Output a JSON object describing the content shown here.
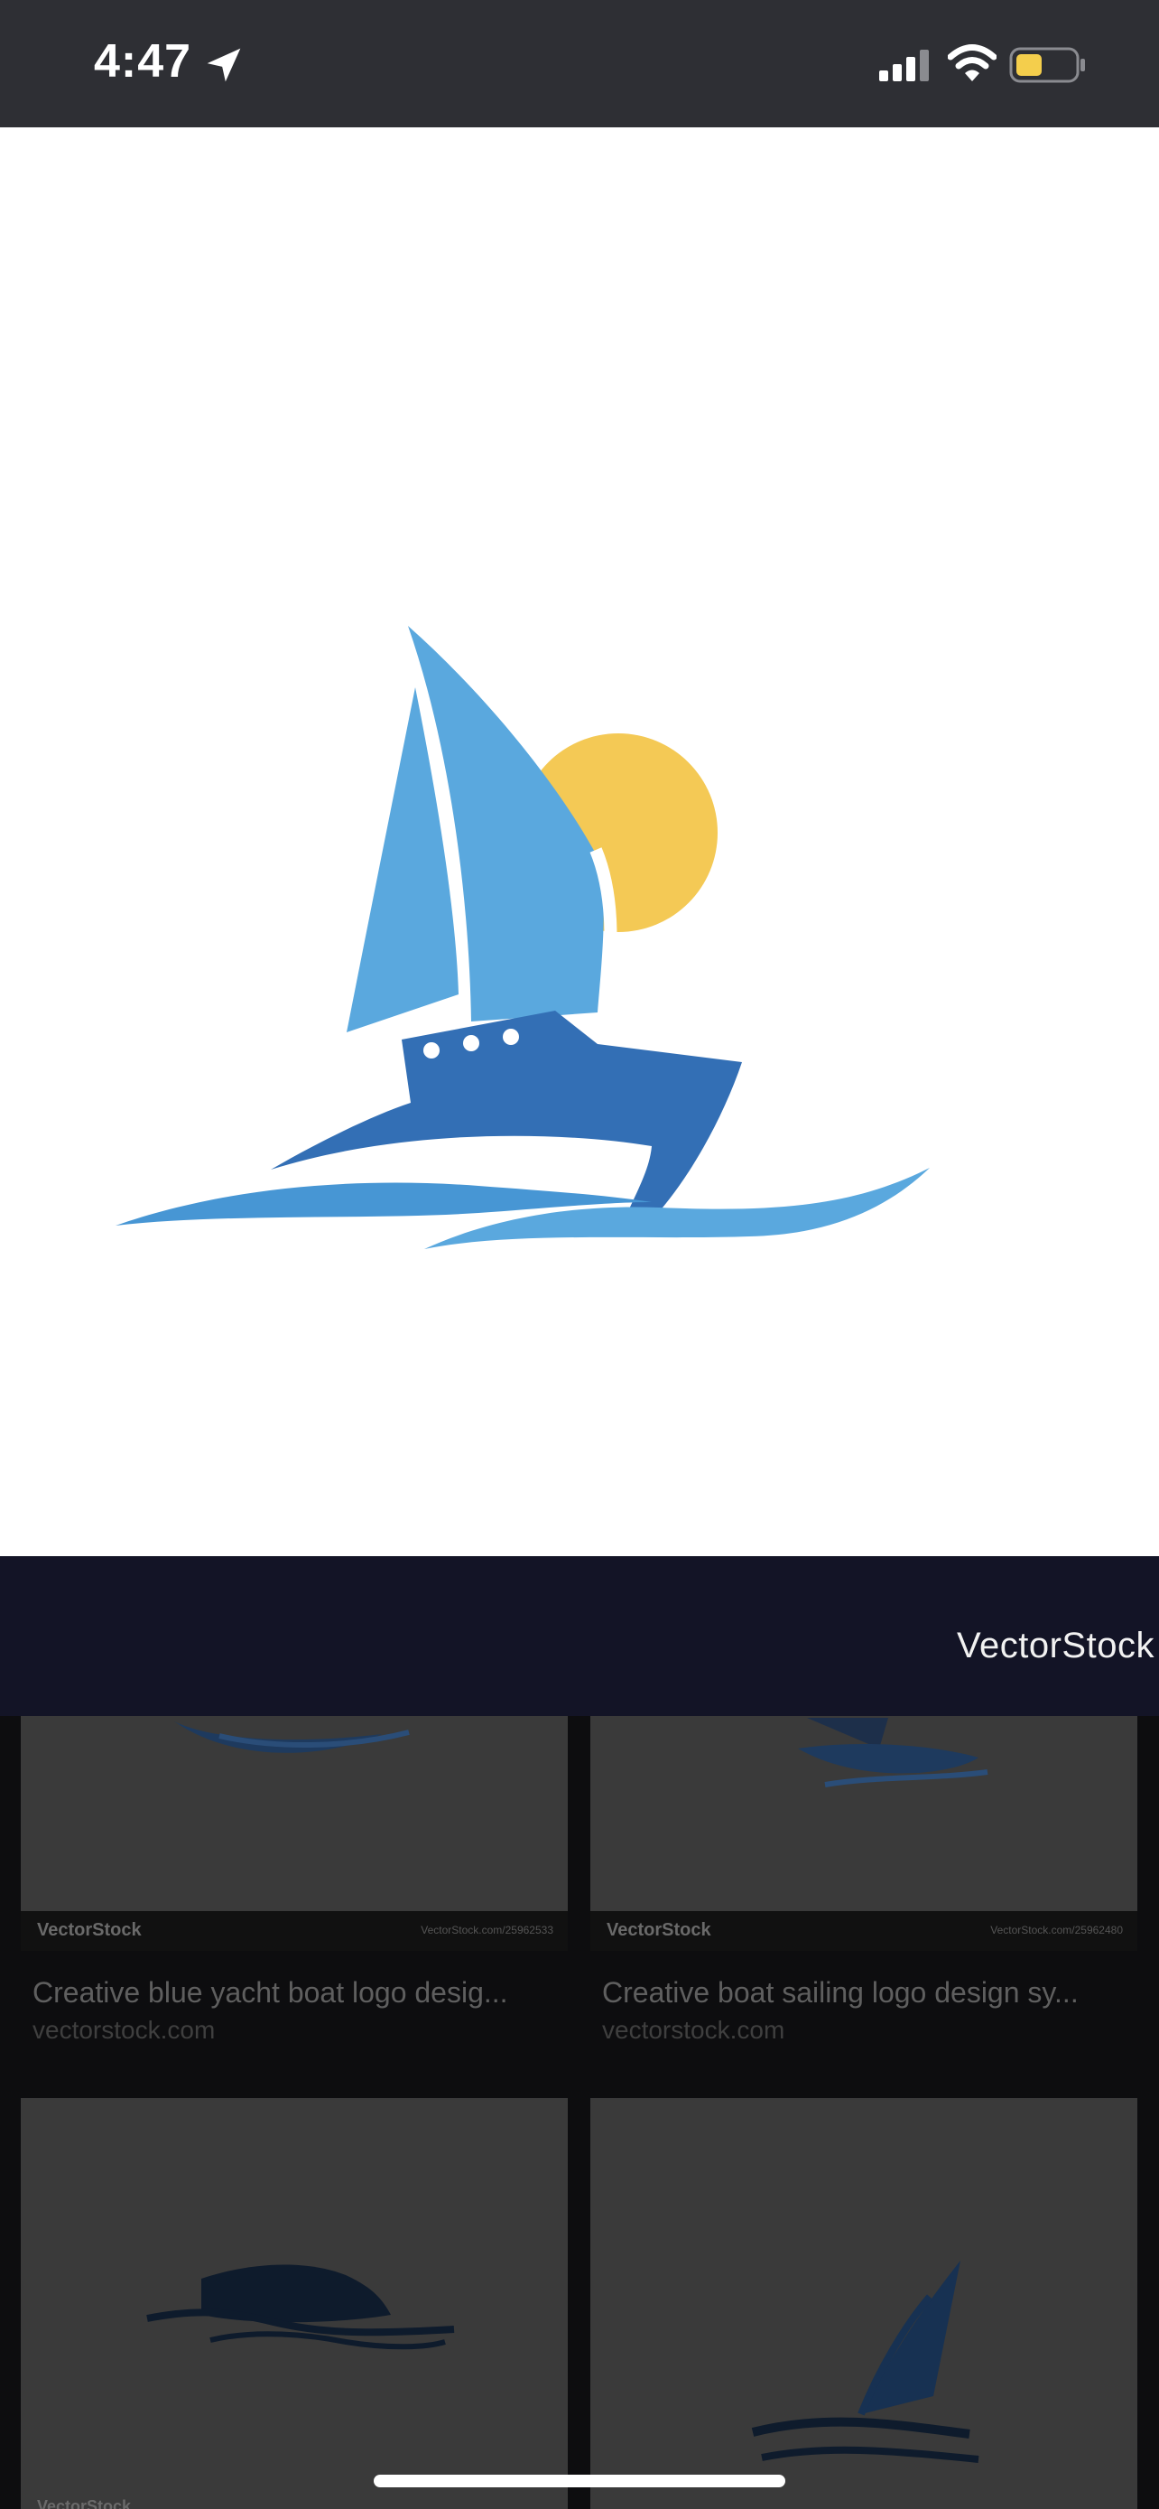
{
  "status_bar": {
    "time": "4:47",
    "icons": [
      "location-arrow-icon",
      "cellular-signal-icon",
      "wifi-icon",
      "battery-icon"
    ],
    "battery_color": "#f4ce4c"
  },
  "viewer": {
    "source_name": "VectorStock",
    "colors": {
      "sail": "#5aa8de",
      "hull": "#336fb5",
      "sun": "#f4c955",
      "header_bar": "#131426"
    }
  },
  "results": [
    {
      "title": "Creative blue yacht boat logo desig...",
      "domain": "vectorstock.com",
      "watermark": "VectorStock",
      "id_text": "VectorStock.com/25962533"
    },
    {
      "title": "Creative boat sailing logo design sy...",
      "domain": "vectorstock.com",
      "watermark": "VectorStock",
      "id_text": "VectorStock.com/25962480"
    },
    {
      "title": "",
      "domain": "",
      "watermark": "VectorStock"
    },
    {
      "title": "",
      "domain": ""
    }
  ]
}
